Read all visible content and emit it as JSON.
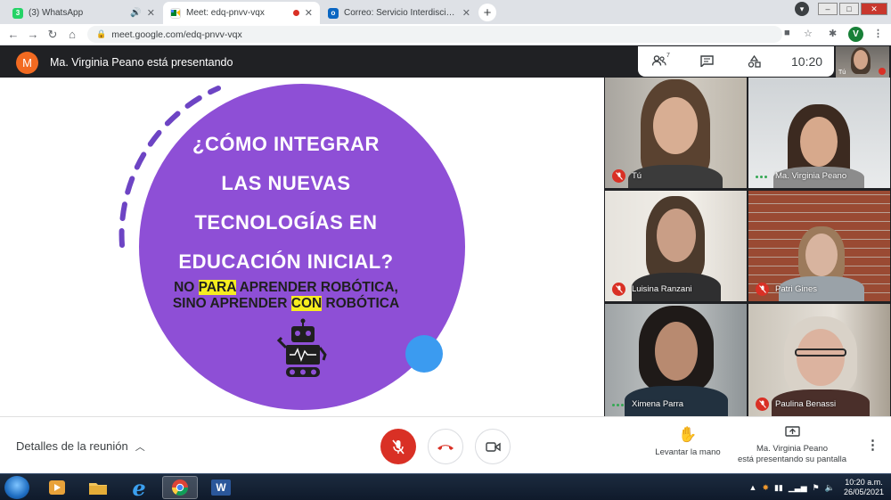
{
  "browser": {
    "tabs": [
      {
        "title": "(3) WhatsApp",
        "favicon_text": "3",
        "favicon_color": "#25d366",
        "active": false
      },
      {
        "title": "Meet: edq-pnvv-vqx",
        "favicon_text": "",
        "favicon_color": "#00897b",
        "active": true
      },
      {
        "title": "Correo: Servicio Interdisciplinario",
        "favicon_text": "o",
        "favicon_color": "#0a66c2",
        "active": false
      }
    ],
    "url": "meet.google.com/edq-pnvv-vqx",
    "profile_initial": "V"
  },
  "meet": {
    "presenter_initial": "M",
    "presenter_banner": "Ma. Virginia Peano está presentando",
    "participant_count": "7",
    "clock": "10:20",
    "self_label": "Tú",
    "slide": {
      "question_lines": [
        "¿CÓMO INTEGRAR",
        "LAS NUEVAS",
        "TECNOLOGÍAS EN",
        "EDUCACIÓN INICIAL?"
      ],
      "line1_before": "NO ",
      "line1_highlight": "PARA",
      "line1_after": " APRENDER ROBÓTICA,",
      "line2_before": "SINO APRENDER ",
      "line2_highlight": "CON",
      "line2_after": " ROBÓTICA",
      "circle_color": "#8e4fd6",
      "highlight_color": "#f6ed1f",
      "dot_color": "#3b9bf0"
    },
    "participants": [
      {
        "name": "Tú",
        "muted": true
      },
      {
        "name": "Ma. Virginia Peano",
        "muted": false
      },
      {
        "name": "Luisina Ranzani",
        "muted": true
      },
      {
        "name": "Patri Gines",
        "muted": true
      },
      {
        "name": "Ximena Parra",
        "muted": false
      },
      {
        "name": "Paulina Benassi",
        "muted": true
      }
    ],
    "bottom": {
      "details_label": "Detalles de la reunión",
      "raise_hand_label": "Levantar la mano",
      "presenting_line1": "Ma. Virginia Peano",
      "presenting_line2": "está presentando su pantalla"
    }
  },
  "taskbar": {
    "time": "10:20 a.m.",
    "date": "26/05/2021",
    "word_label": "W"
  }
}
